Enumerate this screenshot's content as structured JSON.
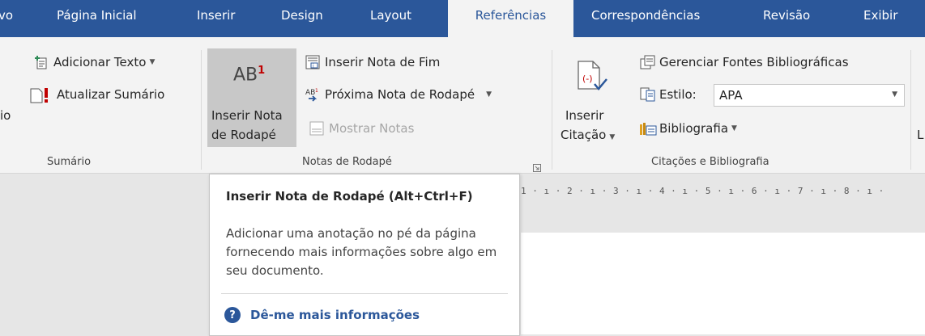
{
  "tabs": [
    {
      "label": "vo"
    },
    {
      "label": "Página Inicial"
    },
    {
      "label": "Inserir"
    },
    {
      "label": "Design"
    },
    {
      "label": "Layout"
    },
    {
      "label": "Referências",
      "active": true
    },
    {
      "label": "Correspondências"
    },
    {
      "label": "Revisão"
    },
    {
      "label": "Exibir"
    }
  ],
  "ribbon": {
    "sumario": {
      "partial_label": "io",
      "adicionar_texto": "Adicionar Texto",
      "atualizar_sumario": "Atualizar Sumário",
      "group_label": "Sumário"
    },
    "notas": {
      "big_icon_text": "AB",
      "big_icon_super": "1",
      "inserir_nota_line1": "Inserir Nota",
      "inserir_nota_line2": "de Rodapé",
      "inserir_nota_fim": "Inserir Nota de Fim",
      "proxima_nota": "Próxima Nota de Rodapé",
      "mostrar_notas": "Mostrar Notas",
      "group_label": "Notas de Rodapé"
    },
    "citacoes": {
      "inserir_line1": "Inserir",
      "inserir_line2": "Citação",
      "gerenciar_fontes": "Gerenciar Fontes Bibliográficas",
      "estilo_label": "Estilo:",
      "estilo_value": "APA",
      "bibliografia": "Bibliografia",
      "group_label": "Citações e Bibliografia"
    },
    "next_group_partial": "L"
  },
  "ruler_text": "1 · ı · 2 · ı · 3 · ı · 4 · ı · 5 · ı · 6 · ı · 7 · ı · 8 · ı · ",
  "tooltip": {
    "title": "Inserir Nota de Rodapé (Alt+Ctrl+F)",
    "description": "Adicionar uma anotação no pé da página fornecendo mais informações sobre algo em seu documento.",
    "link": "Dê-me mais informações",
    "help_glyph": "?"
  },
  "colors": {
    "accent": "#2b579a",
    "ribbon_bg": "#f3f3f3",
    "workspace_bg": "#e6e6e6",
    "footnote_icon_red": "#c00000"
  }
}
